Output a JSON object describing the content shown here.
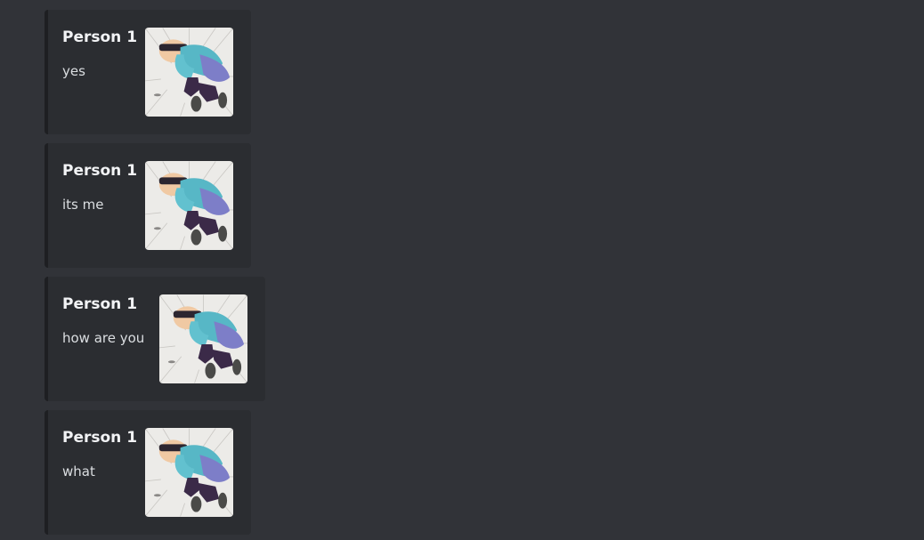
{
  "messages": [
    {
      "author": "Person 1",
      "text": "yes",
      "thumbnail": "sleeping-anime-girl-image"
    },
    {
      "author": "Person 1",
      "text": "its me",
      "thumbnail": "sleeping-anime-girl-image"
    },
    {
      "author": "Person 1",
      "text": "how are you",
      "thumbnail": "sleeping-anime-girl-image"
    },
    {
      "author": "Person 1",
      "text": "what",
      "thumbnail": "sleeping-anime-girl-image"
    }
  ],
  "colors": {
    "background": "#313338",
    "embed_background": "#2b2d31",
    "embed_border": "#1e1f22",
    "author_text": "#f2f3f5",
    "body_text": "#dbdee1"
  }
}
